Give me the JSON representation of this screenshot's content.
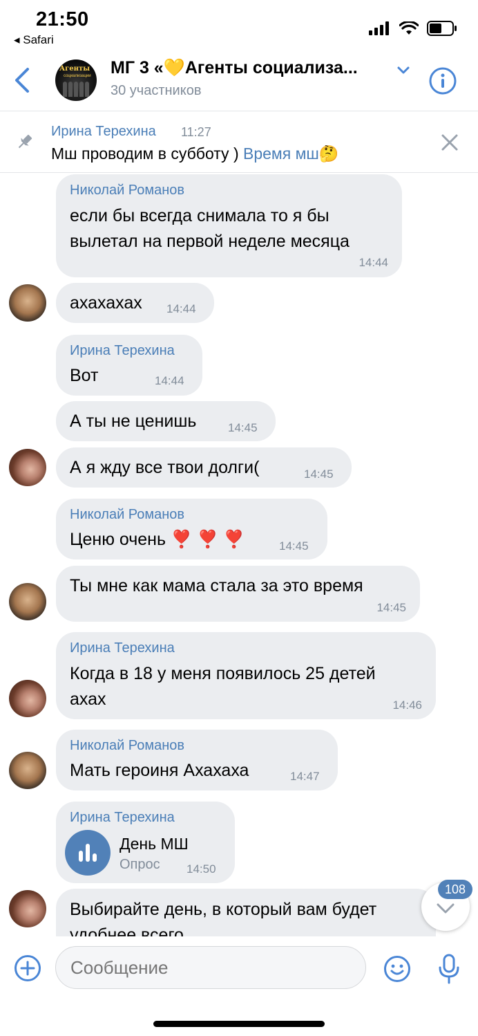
{
  "status_bar": {
    "time": "21:50",
    "back_app": "◂ Safari"
  },
  "header": {
    "title": "МГ 3 «💛Агенты социализа...",
    "subtitle": "30 участников",
    "avatar_text": "Агенты",
    "avatar_subtext": "социализации"
  },
  "pinned": {
    "author": "Ирина Терехина",
    "time": "11:27",
    "text": "Мш проводим в субботу ) ",
    "link": "Время мш🤔"
  },
  "messages": [
    {
      "author": "Николай Романов",
      "lines": [
        "если бы всегда снимала то я бы",
        "вылетал на первой неделе месяца"
      ],
      "time": "14:44"
    },
    {
      "text": "ахахахах",
      "time": "14:44"
    },
    {
      "author": "Ирина Терехина",
      "text": "Вот",
      "time": "14:44"
    },
    {
      "text": "А ты не ценишь",
      "time": "14:45"
    },
    {
      "text": "А я жду все твои долги(",
      "time": "14:45"
    },
    {
      "author": "Николай Романов",
      "text": "Ценю очень ❣️ ❣️ ❣️",
      "time": "14:45"
    },
    {
      "text": "Ты мне как мама стала за это время",
      "time": "14:45"
    },
    {
      "author": "Ирина Терехина",
      "lines": [
        "Когда в 18 у меня появилось 25 детей",
        "ахах"
      ],
      "time": "14:46"
    },
    {
      "author": "Николай Романов",
      "text": "Мать героиня Ахахаха",
      "time": "14:47"
    },
    {
      "author": "Ирина Терехина",
      "poll_title": "День МШ",
      "poll_label": "Опрос",
      "time": "14:50"
    },
    {
      "lines": [
        "Выбирайте день, в который вам будет",
        "удобнее всего"
      ]
    }
  ],
  "unread_count": "108",
  "composer": {
    "placeholder": "Сообщение"
  },
  "colors": {
    "accent": "#5181b8",
    "author": "#4a7eb7",
    "bubble": "#ebedf0",
    "meta": "#818c99"
  },
  "icons": [
    "back-chevron-icon",
    "info-icon",
    "pin-icon",
    "close-icon",
    "chevron-down-icon",
    "poll-icon",
    "add-icon",
    "emoji-icon",
    "microphone-icon"
  ]
}
